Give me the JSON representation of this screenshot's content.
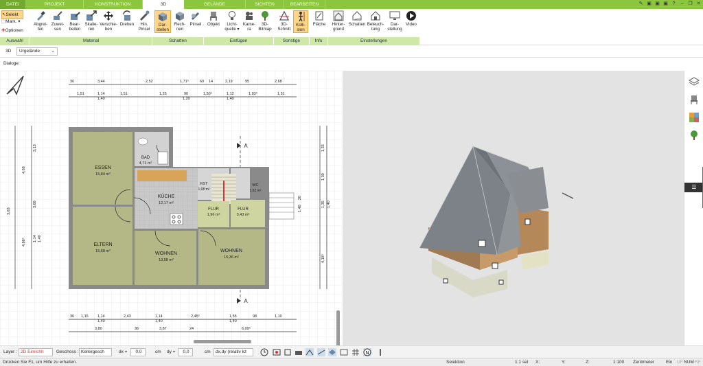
{
  "tabs": [
    "DATEI",
    "PROJEKT",
    "KONSTRUKTION",
    "3D",
    "GELÄNDE",
    "SICHTEN",
    "BEARBEITEN"
  ],
  "auswahl": {
    "selekt": "Selekt",
    "mark": "Mark. ▾",
    "optionen": "Optionen",
    "group": "Auswahl"
  },
  "ribbon": {
    "material": [
      "Abgrei-\nfen",
      "Zuwei-\nsen",
      "Bear-\nbeiten",
      "Skalie-\nren",
      "Verschie-\nben",
      "Drehen",
      "Hin.\nPinsel"
    ],
    "schatten": [
      "Dar-\nstellen",
      "Rech-\nnen",
      "Pinsel"
    ],
    "einfuegen": [
      "Objekt",
      "Licht-\nquelle ▾",
      "Kame-\nra",
      "3D-\nBitmap"
    ],
    "sonstige": [
      "3D-\nSchnitt",
      "Kolli-\nsion"
    ],
    "info": [
      "Fläche"
    ],
    "einstellungen": [
      "Hinter-\ngrund",
      "Schatten",
      "Beleuch-\ntung",
      "Dar-\nstellung",
      "Video"
    ]
  },
  "groups": {
    "material": "Material",
    "schatten": "Schatten",
    "einfuegen": "Einfügen",
    "sonstige": "Sonstige",
    "info": "Info",
    "einstellungen": "Einstellungen"
  },
  "view": {
    "label": "3D",
    "select": "Urgelände",
    "dialoge": "Dialoge:"
  },
  "rooms": [
    {
      "name": "ESSEN",
      "area": "15,84 m²"
    },
    {
      "name": "BAD",
      "area": "4,71 m²"
    },
    {
      "name": "KÜCHE",
      "area": "12,17 m²"
    },
    {
      "name": "FLUR",
      "area": "1,96 m²"
    },
    {
      "name": "FLUR",
      "area": "3,43 m²"
    },
    {
      "name": "ELTERN",
      "area": "15,68 m²"
    },
    {
      "name": "WOHNEN",
      "area": "13,58 m²"
    },
    {
      "name": "WOHNEN",
      "area": "15,36 m²"
    },
    {
      "name": "WC",
      "area": "1,52 m²"
    },
    {
      "name": "RST",
      "area": "1,08 m²"
    }
  ],
  "dims": {
    "top1": [
      "36",
      "3,44",
      "2,52",
      "1,71⁵",
      "69",
      "14",
      "2,19",
      "95",
      "2,68"
    ],
    "top2": [
      "1,51",
      "1,14",
      "1,40",
      "1,51",
      "1,25",
      "90",
      "1,20",
      "1,50⁵",
      "1,12",
      "1,40",
      "1,93⁵",
      "1,51"
    ],
    "bottom1": [
      "36",
      "1,15",
      "1,14",
      "1,40",
      "2,43",
      "1,14",
      "1,40",
      "2,45⁵",
      "1,55",
      "1,40",
      "98",
      "1,10"
    ],
    "bottom2": [
      "3,80",
      "36",
      "3,87",
      "24",
      "6,09⁵"
    ],
    "left": [
      "3,13",
      "4,68",
      "3,68",
      "4,66⁵",
      "1,14",
      "1,40",
      "3,63"
    ],
    "right": [
      "1,33",
      "1,30",
      "1,35",
      "1,40",
      "4,18⁵",
      "20",
      "1,40"
    ],
    "section": "A"
  },
  "status": {
    "layer_label": "Layer :",
    "layer": "2D Einrichh",
    "geschoss_label": "Geschoss :",
    "geschoss": "Kellergesch",
    "dx_label": "dx =",
    "dx": "0,0",
    "unit1": "cm",
    "dy_label": "dy =",
    "dy": "0,0",
    "unit2": "cm",
    "rel": "dx,dy (relativ kz"
  },
  "footer": {
    "help": "Drücken Sie F1, um Hilfe zu erhalten.",
    "mode": "Selektion",
    "scale1": "1:1 sel",
    "x": "X:",
    "y": "Y:",
    "z": "Z:",
    "scale": "1:100",
    "unit": "Zentimeter",
    "ein": "Ein",
    "uf": "UF",
    "num": "NUM",
    "rf": "RF"
  },
  "colors": {
    "green": "#8cc63f",
    "floor": "#b3b886",
    "kitchen": "#c5c5c5",
    "wall": "#8a8a8a"
  }
}
